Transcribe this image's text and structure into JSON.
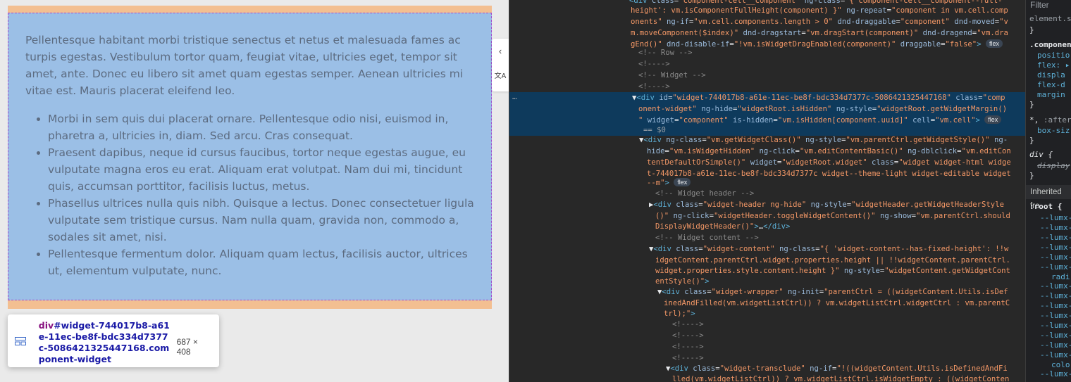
{
  "widget": {
    "paragraph": "Pellentesque habitant morbi tristique senectus et netus et malesuada fames ac turpis egestas. Vestibulum tortor quam, feugiat vitae, ultricies eget, tempor sit amet, ante. Donec eu libero sit amet quam egestas semper. Aenean ultricies mi vitae est. Mauris placerat eleifend leo.",
    "items": [
      "Morbi in sem quis dui placerat ornare. Pellentesque odio nisi, euismod in, pharetra a, ultricies in, diam. Sed arcu. Cras consequat.",
      "Praesent dapibus, neque id cursus faucibus, tortor neque egestas augue, eu vulputate magna eros eu erat. Aliquam erat volutpat. Nam dui mi, tincidunt quis, accumsan porttitor, facilisis luctus, metus.",
      "Phasellus ultrices nulla quis nibh. Quisque a lectus. Donec consectetuer ligula vulputate sem tristique cursus. Nam nulla quam, gravida non, commodo a, sodales sit amet, nisi.",
      "Pellentesque fermentum dolor. Aliquam quam lectus, facilisis auctor, ultrices ut, elementum vulputate, nunc."
    ]
  },
  "side_tools": {
    "collapse": "‹",
    "translate": "文A"
  },
  "tooltip": {
    "tag": "div",
    "selector": "#widget-744017b8-a61e-11ec-be8f-bdc334d7377c-5086421325447168.component-widget",
    "size": "687 × 408"
  },
  "devtools": {
    "badge": "flex",
    "dots": "…",
    "selected_suffix": "== $0",
    "styles": {
      "filter": "Filter",
      "inherited": "Inherited fro",
      "root": ":root {"
    }
  },
  "colors": {
    "widget_bg": "#9bbfe6",
    "margin": "#f3bf91",
    "devtools_bg": "#282828",
    "selection": "#0e3a5c"
  }
}
